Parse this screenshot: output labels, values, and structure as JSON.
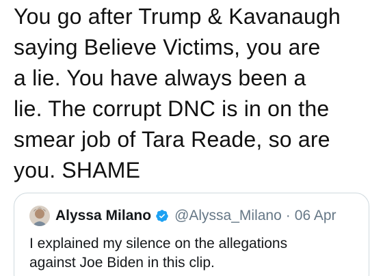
{
  "tweet": {
    "text": "You go after Trump & Kavanaugh\nsaying Believe Victims, you are\na lie. You have always been a\nlie. The corrupt DNC is in on the\nsmear job of Tara Reade, so are\nyou. SHAME"
  },
  "quoted_tweet": {
    "name": "Alyssa Milano",
    "handle": "@Alyssa_Milano",
    "separator": "·",
    "date": "06 Apr",
    "text": "I explained my silence on the allegations\nagainst Joe Biden in this clip.",
    "verified_icon": "verified-badge-icon",
    "verified_color": "#1da1f2",
    "avatar_icon": "profile-avatar"
  }
}
